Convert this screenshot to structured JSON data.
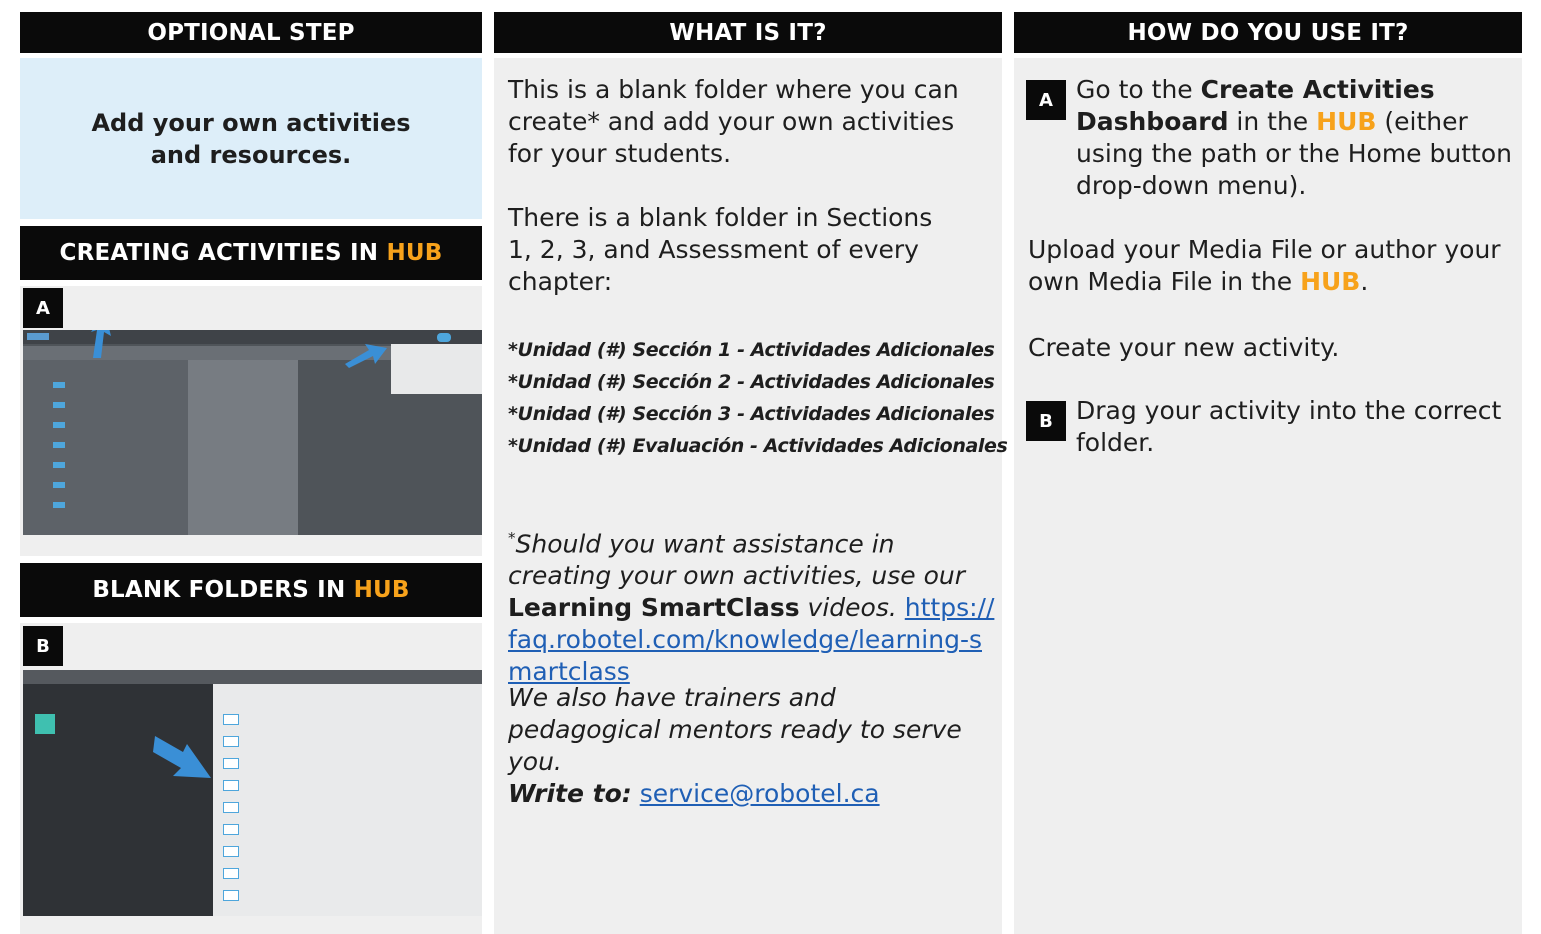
{
  "col1": {
    "header": "OPTIONAL STEP",
    "intro_line1": "Add your own activities",
    "intro_line2": "and resources.",
    "section_a": {
      "title_prefix": "CREATING ACTIVITIES IN ",
      "title_hub": "HUB",
      "badge": "A"
    },
    "section_b": {
      "title_prefix": "BLANK FOLDERS IN ",
      "title_hub": "HUB",
      "badge": "B"
    }
  },
  "col2": {
    "header": "WHAT IS IT?",
    "para1": "This is a blank folder where you can create* and add your own activities for your students.",
    "para2": "There is a blank folder in Sections 1, 2, 3, and Assessment of every chapter:",
    "folders": [
      "*Unidad (#) Sección 1 - Actividades Adicionales",
      "*Unidad (#) Sección 2 - Actividades Adicionales",
      "*Unidad (#) Sección 3 - Actividades Adicionales",
      "*Unidad (#) Evaluación - Actividades Adicionales"
    ],
    "assist_star": "*",
    "assist_1": "Should you want assistance in creating your own activities, use our ",
    "assist_bold": "Learning SmartClass",
    "assist_2": " videos. ",
    "assist_link": "https://faq.robotel.com/knowledge/learning-smartclass",
    "trainers": "We also have trainers and pedagogical mentors ready to serve you.",
    "write_label": "Write to:",
    "email": "service@robotel.ca"
  },
  "col3": {
    "header": "HOW DO YOU USE IT?",
    "step_a_badge": "A",
    "step_a_1": "Go to the ",
    "step_a_bold": "Create Activities Dashboard",
    "step_a_2": " in the ",
    "step_a_hub": "HUB",
    "step_a_3": " (either using the path or the Home button drop-down menu).",
    "upload_1": "Upload your Media File or author your own Media File in the ",
    "upload_hub": "HUB",
    "upload_2": ".",
    "create": "Create your new activity.",
    "step_b_badge": "B",
    "step_b": "Drag your activity into the correct folder."
  },
  "colors": {
    "accent": "#f7a21b",
    "header_bg": "#0a0a0a",
    "panel_bg": "#efefef",
    "intro_bg": "#ddeef9",
    "link": "#1f5fb5"
  }
}
